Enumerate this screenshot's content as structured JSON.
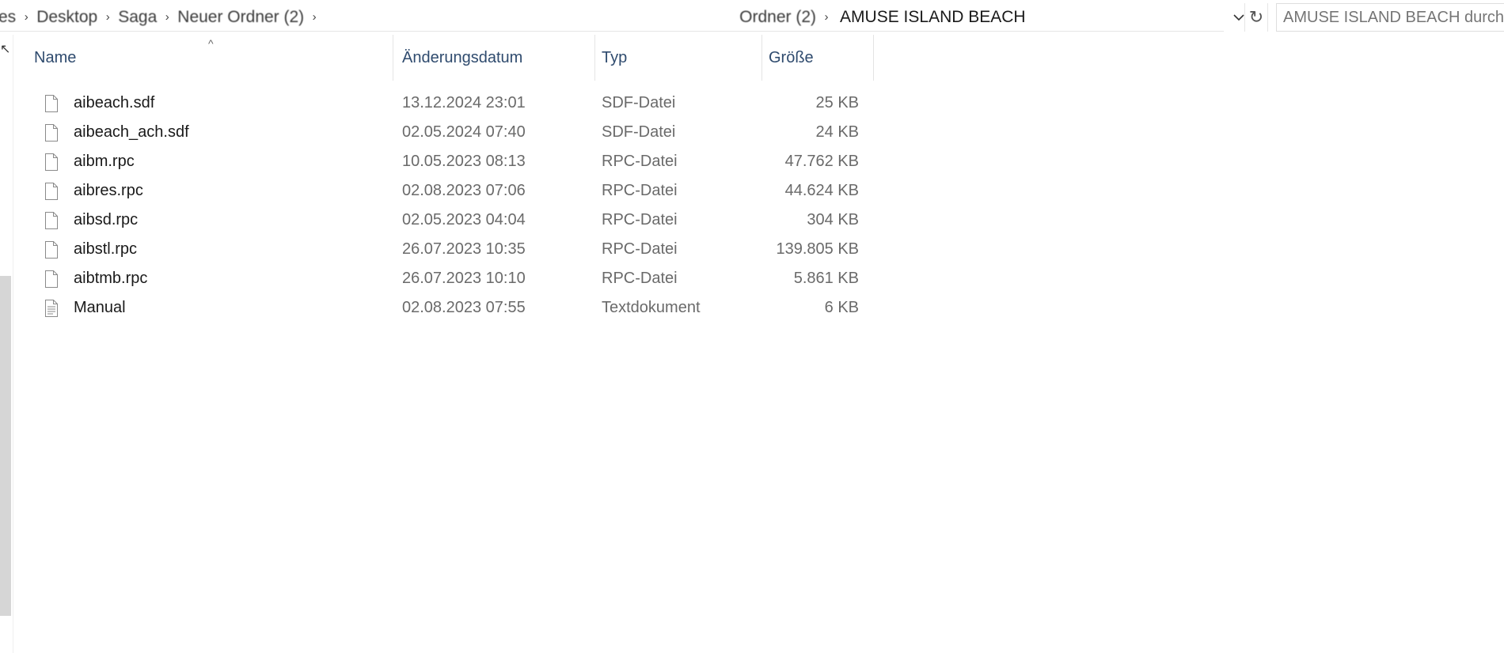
{
  "address": {
    "crumbs": [
      "es",
      "Desktop",
      "Saga",
      "Neuer Ordner (2)",
      "",
      "",
      "",
      "Ordner (2)"
    ],
    "current": "AMUSE ISLAND BEACH"
  },
  "search": {
    "placeholder": "AMUSE ISLAND BEACH durchsuchen"
  },
  "columns": {
    "name": "Name",
    "date": "Änderungsdatum",
    "type": "Typ",
    "size": "Größe"
  },
  "icons": {
    "file": "blank-file-icon",
    "text": "text-document-icon",
    "refresh": "refresh-icon",
    "dropdown": "chevron-down-icon",
    "sort": "sort-ascending-icon"
  },
  "files": [
    {
      "name": "aibeach.sdf",
      "date": "13.12.2024 23:01",
      "type": "SDF-Datei",
      "size": "25 KB",
      "icon": "file"
    },
    {
      "name": "aibeach_ach.sdf",
      "date": "02.05.2024 07:40",
      "type": "SDF-Datei",
      "size": "24 KB",
      "icon": "file"
    },
    {
      "name": "aibm.rpc",
      "date": "10.05.2023 08:13",
      "type": "RPC-Datei",
      "size": "47.762 KB",
      "icon": "file"
    },
    {
      "name": "aibres.rpc",
      "date": "02.08.2023 07:06",
      "type": "RPC-Datei",
      "size": "44.624 KB",
      "icon": "file"
    },
    {
      "name": "aibsd.rpc",
      "date": "02.05.2023 04:04",
      "type": "RPC-Datei",
      "size": "304 KB",
      "icon": "file"
    },
    {
      "name": "aibstl.rpc",
      "date": "26.07.2023 10:35",
      "type": "RPC-Datei",
      "size": "139.805 KB",
      "icon": "file"
    },
    {
      "name": "aibtmb.rpc",
      "date": "26.07.2023 10:10",
      "type": "RPC-Datei",
      "size": "5.861 KB",
      "icon": "file"
    },
    {
      "name": "Manual",
      "date": "02.08.2023 07:55",
      "type": "Textdokument",
      "size": "6 KB",
      "icon": "text"
    }
  ]
}
